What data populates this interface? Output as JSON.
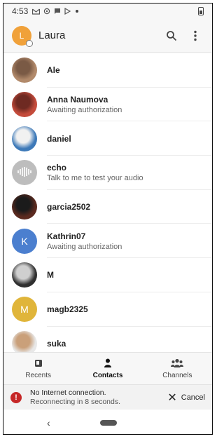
{
  "statusbar": {
    "time": "4:53",
    "icons": [
      "gmail-icon",
      "sync-icon",
      "message-icon",
      "play-store-icon",
      "dot-icon"
    ],
    "battery": "battery-icon"
  },
  "appbar": {
    "avatar_initial": "L",
    "title": "Laura",
    "actions": [
      "search-icon",
      "more-vert-icon"
    ]
  },
  "contacts": [
    {
      "name": "Ale",
      "subtitle": "",
      "avatar": {
        "type": "photo",
        "colors": [
          "#b28a6b",
          "#7a5a45"
        ]
      }
    },
    {
      "name": "Anna Naumova",
      "subtitle": "Awaiting authorization",
      "avatar": {
        "type": "photo",
        "colors": [
          "#c44b3b",
          "#6e2a22"
        ]
      }
    },
    {
      "name": "daniel",
      "subtitle": "",
      "avatar": {
        "type": "photo",
        "colors": [
          "#3d79b8",
          "#f1f1f1"
        ]
      }
    },
    {
      "name": "echo",
      "subtitle": "Talk to me to test your audio",
      "avatar": {
        "type": "icon",
        "bg": "#bdbdbd",
        "icon": "audio-wave-icon"
      }
    },
    {
      "name": "garcia2502",
      "subtitle": "",
      "avatar": {
        "type": "photo",
        "colors": [
          "#5b2a1f",
          "#1b1b1b"
        ]
      }
    },
    {
      "name": "Kathrin07",
      "subtitle": "Awaiting authorization",
      "avatar": {
        "type": "initial",
        "bg": "#4b7fcf",
        "initial": "K"
      }
    },
    {
      "name": "M",
      "subtitle": "",
      "avatar": {
        "type": "photo",
        "colors": [
          "#2f2f2f",
          "#cfcfcf"
        ]
      }
    },
    {
      "name": "magb2325",
      "subtitle": "",
      "avatar": {
        "type": "initial",
        "bg": "#e0b53a",
        "initial": "M"
      }
    },
    {
      "name": "suka",
      "subtitle": "",
      "avatar": {
        "type": "photo",
        "colors": [
          "#e8e8e8",
          "#caa07a"
        ]
      }
    }
  ],
  "bottom_nav": [
    {
      "label": "Recents",
      "icon": "recents-icon",
      "active": false
    },
    {
      "label": "Contacts",
      "icon": "person-icon",
      "active": true
    },
    {
      "label": "Channels",
      "icon": "group-icon",
      "active": false
    }
  ],
  "snackbar": {
    "line1": "No Internet connection.",
    "line2": "Reconnecting in 8 seconds.",
    "cancel_label": "Cancel",
    "error_color": "#c62828"
  },
  "system_nav": {
    "back_icon": "back-chevron-icon",
    "home_icon": "home-pill-icon"
  }
}
